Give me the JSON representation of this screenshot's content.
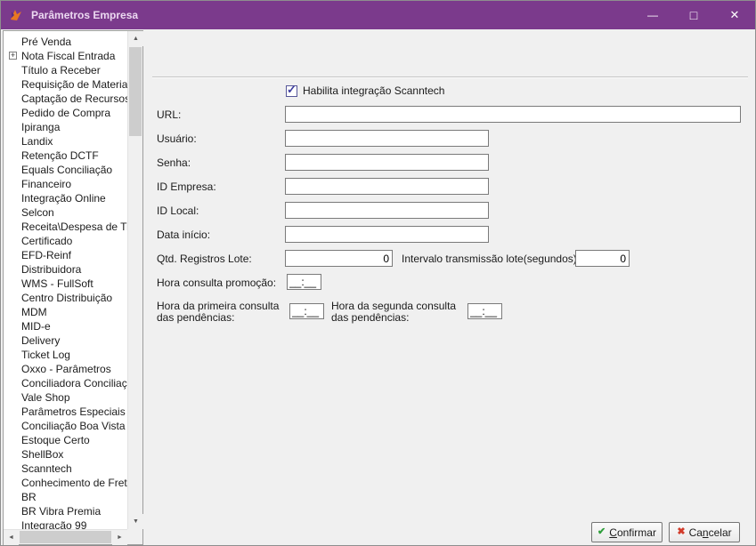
{
  "colors": {
    "titlebar": "#7b3a8c",
    "title_text": "#ecd9f1",
    "check_accent": "#3f3f9f",
    "confirm_icon": "#2e9e3a",
    "cancel_icon": "#d23b2a",
    "panel_bg": "#f0f0f0"
  },
  "window": {
    "title": "Parâmetros Empresa"
  },
  "icons": {
    "minimize": "—",
    "maximize": "□",
    "close": "✕",
    "expand": "+",
    "check": "✓",
    "confirm": "✔",
    "cancel": "✖",
    "scroll_up": "▲",
    "scroll_down": "▼",
    "scroll_left": "◄",
    "scroll_right": "►"
  },
  "sidebar": {
    "items": [
      {
        "label": "Pré Venda",
        "expandable": false
      },
      {
        "label": "Nota Fiscal Entrada",
        "expandable": true
      },
      {
        "label": "Título a Receber",
        "expandable": false
      },
      {
        "label": "Requisição de Materiais",
        "expandable": false
      },
      {
        "label": "Captação de Recursos",
        "expandable": false
      },
      {
        "label": "Pedido de Compra",
        "expandable": false
      },
      {
        "label": "Ipiranga",
        "expandable": false
      },
      {
        "label": "Landix",
        "expandable": false
      },
      {
        "label": "Retenção DCTF",
        "expandable": false
      },
      {
        "label": "Equals Conciliação",
        "expandable": false
      },
      {
        "label": "Financeiro",
        "expandable": false
      },
      {
        "label": "Integração Online",
        "expandable": false
      },
      {
        "label": "Selcon",
        "expandable": false
      },
      {
        "label": "Receita\\Despesa de Titul",
        "expandable": false
      },
      {
        "label": "Certificado",
        "expandable": false
      },
      {
        "label": "EFD-Reinf",
        "expandable": false
      },
      {
        "label": "Distribuidora",
        "expandable": false
      },
      {
        "label": "WMS - FullSoft",
        "expandable": false
      },
      {
        "label": "Centro Distribuição",
        "expandable": false
      },
      {
        "label": "MDM",
        "expandable": false
      },
      {
        "label": "MID-e",
        "expandable": false
      },
      {
        "label": "Delivery",
        "expandable": false
      },
      {
        "label": "Ticket Log",
        "expandable": false
      },
      {
        "label": "Oxxo - Parâmetros",
        "expandable": false
      },
      {
        "label": "Conciliadora Conciliação",
        "expandable": false
      },
      {
        "label": "Vale Shop",
        "expandable": false
      },
      {
        "label": "Parâmetros Especiais",
        "expandable": false
      },
      {
        "label": "Conciliação Boa Vista",
        "expandable": false
      },
      {
        "label": "Estoque Certo",
        "expandable": false
      },
      {
        "label": "ShellBox",
        "expandable": false
      },
      {
        "label": "Scanntech",
        "expandable": false
      },
      {
        "label": "Conhecimento de Frete",
        "expandable": false
      },
      {
        "label": "BR",
        "expandable": false
      },
      {
        "label": "BR Vibra Premia",
        "expandable": false
      },
      {
        "label": "Integração 99",
        "expandable": false
      }
    ]
  },
  "form": {
    "scanntech_checkbox": {
      "label": "Habilita integração Scanntech",
      "checked": true
    },
    "url": {
      "label": "URL:",
      "value": ""
    },
    "usuario": {
      "label": "Usuário:",
      "value": ""
    },
    "senha": {
      "label": "Senha:",
      "value": ""
    },
    "id_empresa": {
      "label": "ID Empresa:",
      "value": ""
    },
    "id_local": {
      "label": "ID Local:",
      "value": ""
    },
    "data_inicio": {
      "label": "Data início:",
      "value": ""
    },
    "qtd_registros": {
      "label": "Qtd. Registros Lote:",
      "value": "0"
    },
    "intervalo": {
      "label": "Intervalo transmissão lote(segundos):",
      "value": "0"
    },
    "hora_promocao": {
      "label": "Hora consulta promoção:",
      "value": "__:__"
    },
    "hora_primeira": {
      "label_line1": "Hora da primeira consulta",
      "label_line2": "das pendências:",
      "value": "__:__"
    },
    "hora_segunda": {
      "label_line1": "Hora da segunda consulta",
      "label_line2": "das pendências:",
      "value": "__:__"
    }
  },
  "footer": {
    "confirm": {
      "pre": "",
      "key": "C",
      "post": "onfirmar"
    },
    "cancel": {
      "pre": "Ca",
      "key": "n",
      "post": "celar"
    }
  }
}
